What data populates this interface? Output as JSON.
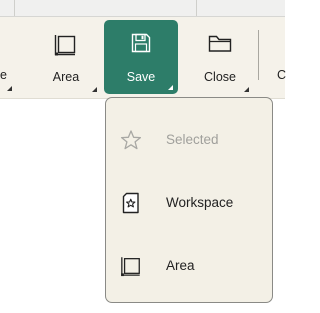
{
  "ribbon": {
    "partial_left_label": "e",
    "partial_right_label": "C",
    "buttons": [
      {
        "name": "Area",
        "icon": "area-icon"
      },
      {
        "name": "Save",
        "icon": "save-icon"
      },
      {
        "name": "Close",
        "icon": "folder-icon"
      }
    ]
  },
  "save_menu": {
    "items": [
      {
        "label": "Selected",
        "icon": "star-icon",
        "enabled": false
      },
      {
        "label": "Workspace",
        "icon": "workspace-icon",
        "enabled": true
      },
      {
        "label": "Area",
        "icon": "area-icon",
        "enabled": true
      }
    ]
  },
  "colors": {
    "save_active": "#2d7d69",
    "ribbon_bg": "#f5f2ea",
    "menu_bg": "#f3f0e6",
    "disabled_text": "#a0a09c"
  }
}
